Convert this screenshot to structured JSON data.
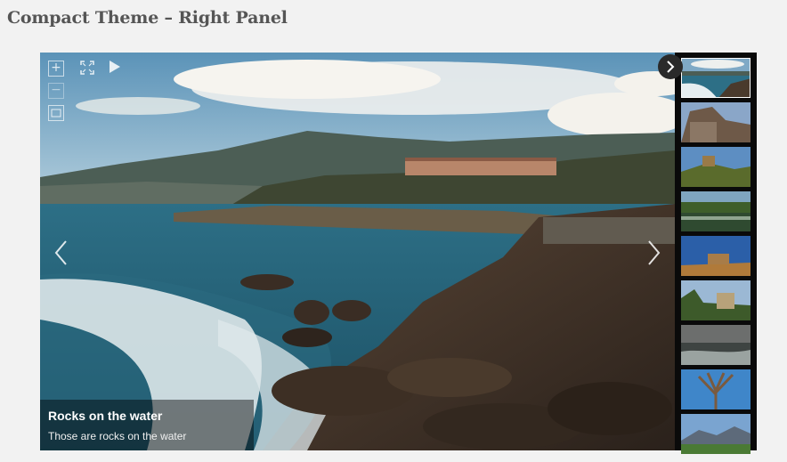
{
  "page": {
    "title": "Compact Theme – Right Panel"
  },
  "slide": {
    "caption_title": "Rocks on the water",
    "caption_description": "Those are rocks on the water"
  },
  "controls": {
    "zoom_in": "+",
    "zoom_out": "−",
    "icons": [
      "zoom-in-icon",
      "zoom-out-icon",
      "fit-screen-icon",
      "fullscreen-icon",
      "play-icon",
      "chevron-left-icon",
      "chevron-right-icon",
      "panel-toggle-chevron-icon"
    ]
  },
  "thumbnails": [
    {
      "name": "thumbnail-coast",
      "active": true
    },
    {
      "name": "thumbnail-ruins",
      "active": false
    },
    {
      "name": "thumbnail-castle-hill",
      "active": false
    },
    {
      "name": "thumbnail-forest-lake",
      "active": false
    },
    {
      "name": "thumbnail-fortress",
      "active": false
    },
    {
      "name": "thumbnail-chateau",
      "active": false
    },
    {
      "name": "thumbnail-stormy-sea",
      "active": false
    },
    {
      "name": "thumbnail-bare-tree",
      "active": false
    },
    {
      "name": "thumbnail-mountains",
      "active": false
    }
  ],
  "colors": {
    "title": "#555555",
    "panel": "#0a0a0a",
    "caption_bg": "rgba(0,0,0,0.45)"
  }
}
